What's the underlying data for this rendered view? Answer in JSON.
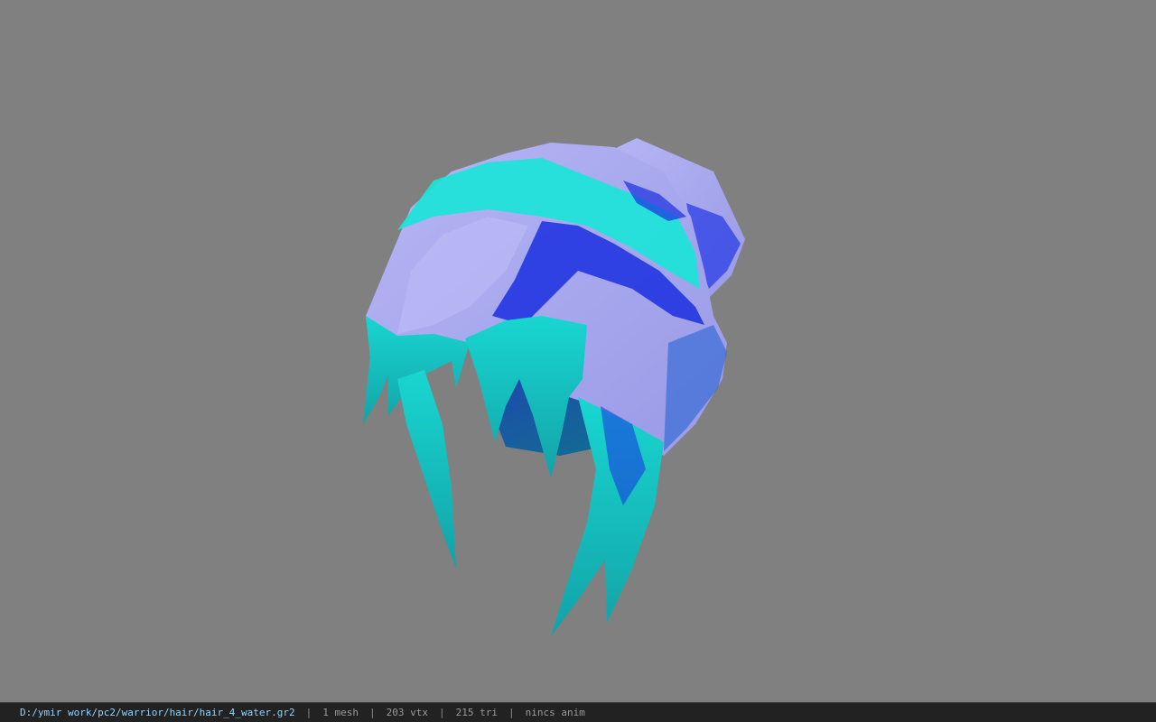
{
  "viewport": {
    "background": "#808080",
    "model": "hair-mesh",
    "colors": {
      "lavender": "#a9a9f2",
      "cyan": "#19e6d8",
      "blue": "#1a2fe0",
      "teal_dark": "#0e8a8a"
    }
  },
  "statusbar": {
    "file_path": "D:/ymir work/pc2/warrior/hair/hair_4_water.gr2",
    "separator": "|",
    "mesh_count": "1 mesh",
    "vertex_count": "203 vtx",
    "triangle_count": "215 tri",
    "anim_status": "nincs anim"
  }
}
